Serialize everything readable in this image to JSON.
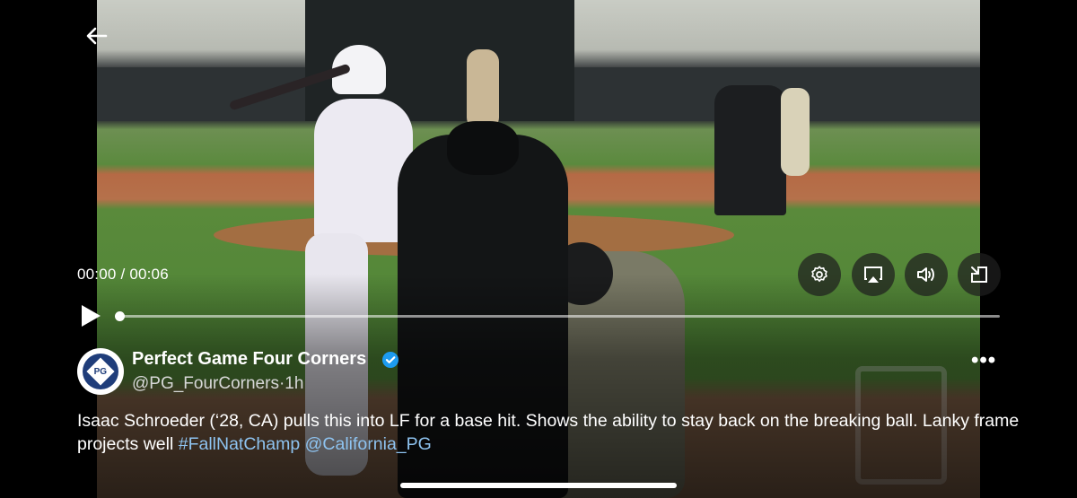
{
  "player": {
    "current_time": "00:00",
    "separator": " / ",
    "duration": "00:06",
    "progress": 0.0
  },
  "post": {
    "account_name": "Perfect Game Four Corners",
    "handle": "@PG_FourCorners",
    "dot": "·",
    "age": "1h",
    "avatar_text": "PG",
    "text_main": "Isaac Schroeder (‘28, CA) pulls this into LF for a base hit. Shows the ability to stay back on the breaking ball. Lanky frame projects well ",
    "hashtag": "#FallNatChamp",
    "mention": "@California_PG",
    "more_label": "•••"
  },
  "icons": [
    "back-arrow-icon",
    "settings-gear-icon",
    "airplay-icon",
    "volume-icon",
    "exit-fullscreen-icon",
    "play-icon",
    "verified-badge-icon",
    "more-options-icon"
  ],
  "colors": {
    "link": "#8ec3f0",
    "verified": "#1d9bf0",
    "control_bg": "#1e1e1e"
  }
}
